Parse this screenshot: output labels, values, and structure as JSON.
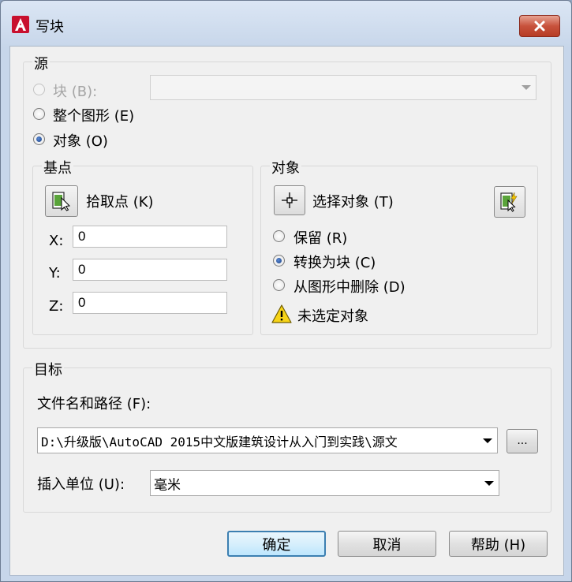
{
  "window": {
    "title": "写块"
  },
  "source": {
    "label": "源",
    "block_option": "块 (B):",
    "entire_drawing_option": "整个图形 (E)",
    "objects_option": "对象 (O)",
    "block_combo_value": ""
  },
  "base_point": {
    "label": "基点",
    "pick_point_label": "拾取点 (K)",
    "x_label": "X:",
    "x_value": "0",
    "y_label": "Y:",
    "y_value": "0",
    "z_label": "Z:",
    "z_value": "0"
  },
  "objects": {
    "label": "对象",
    "select_objects_label": "选择对象 (T)",
    "retain_option": "保留 (R)",
    "convert_option": "转换为块 (C)",
    "delete_option": "从图形中删除 (D)",
    "warning_text": "未选定对象"
  },
  "destination": {
    "label": "目标",
    "filename_label": "文件名和路径 (F):",
    "filename_value": "D:\\升级版\\AutoCAD 2015中文版建筑设计从入门到实践\\源文",
    "browse_label": "...",
    "units_label": "插入单位 (U):",
    "units_value": "毫米"
  },
  "buttons": {
    "ok": "确定",
    "cancel": "取消",
    "help": "帮助 (H)"
  }
}
